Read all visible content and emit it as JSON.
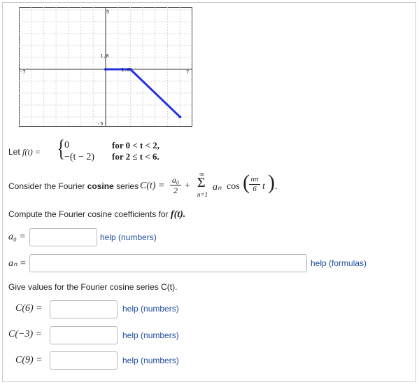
{
  "graph": {
    "labels": {
      "top": "5",
      "bottom": "-5",
      "left": "-7",
      "right": "7",
      "point_a": "1,0",
      "point_b": "1.0"
    },
    "axis_range": {
      "x": [
        -7,
        7
      ],
      "y": [
        -5,
        5
      ]
    },
    "line_color": "#2233dd",
    "segments": [
      [
        [
          0,
          0
        ],
        [
          2,
          0
        ]
      ],
      [
        [
          2,
          0
        ],
        [
          6,
          -4
        ]
      ]
    ]
  },
  "problem": {
    "let_prefix": "Let",
    "f_lhs": "f(t) =",
    "case1_expr": "0",
    "case2_expr": "−(t − 2)",
    "case1_cond": "for 0 < t < 2,",
    "case2_cond": "for 2 ≤ t < 6.",
    "consider_prefix": "Consider the Fourier ",
    "consider_bold": "cosine",
    "consider_suffix": " series",
    "series_lhs": "C(t) =",
    "frac_num": "a₀",
    "frac_den": "2",
    "plus": "+",
    "sum_upper": "∞",
    "sum_symbol": "Σ",
    "sum_lower": "n=1",
    "term_coef": "aₙ",
    "term_cos": "cos",
    "arg_num": "nπ",
    "arg_den": "6",
    "arg_var": "t",
    "compute_text": "Compute the Fourier cosine coefficients for",
    "compute_var": "f(t)."
  },
  "coefficients": {
    "a0_label": "a₀ =",
    "a0_value": "",
    "a0_help": "help (numbers)",
    "an_label": "aₙ =",
    "an_value": "",
    "an_help": "help (formulas)"
  },
  "values": {
    "instruction": "Give values for the Fourier cosine series C(t).",
    "items": [
      {
        "label": "C(6) =",
        "value": "",
        "help": "help (numbers)"
      },
      {
        "label": "C(−3) =",
        "value": "",
        "help": "help (numbers)"
      },
      {
        "label": "C(9) =",
        "value": "",
        "help": "help (numbers)"
      }
    ]
  }
}
